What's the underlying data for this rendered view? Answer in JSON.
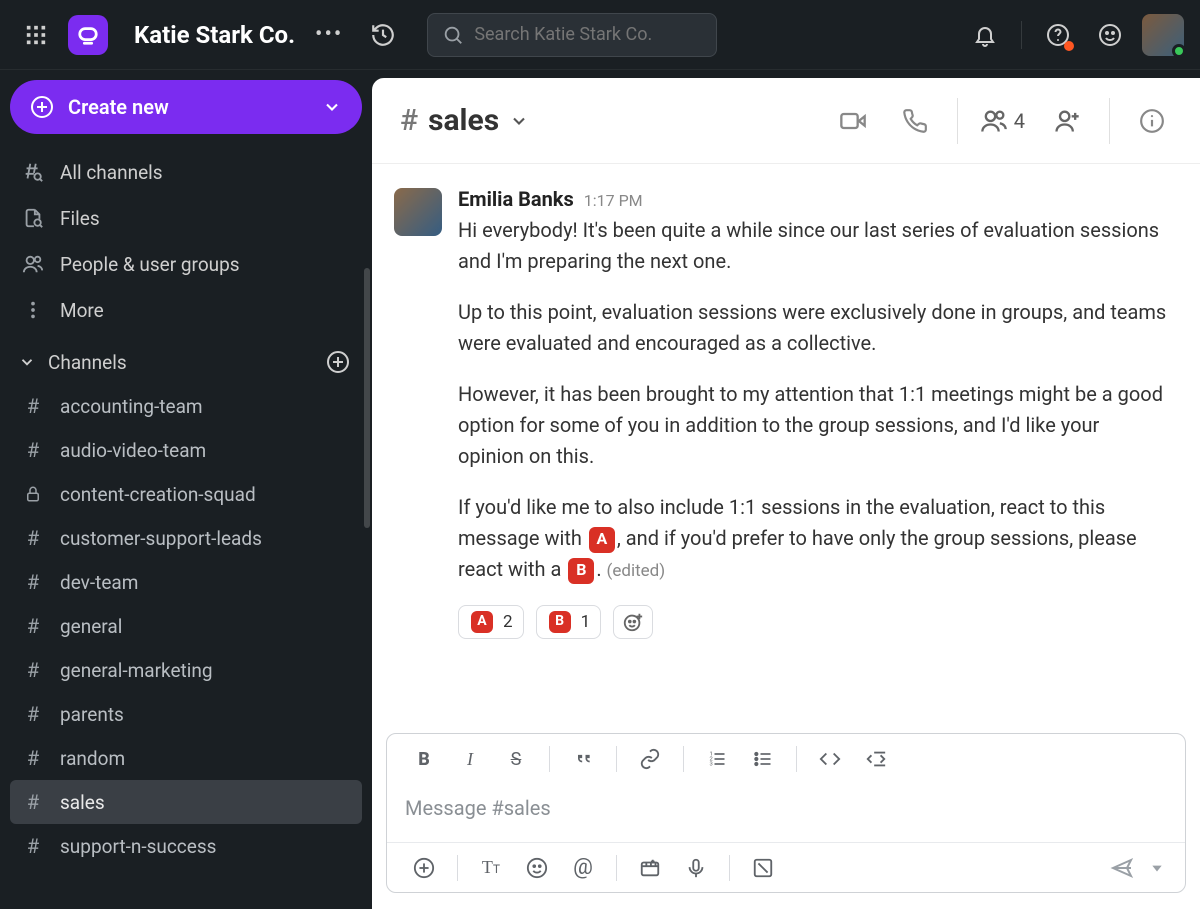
{
  "workspace": {
    "name": "Katie Stark Co."
  },
  "search": {
    "placeholder": "Search Katie Stark Co."
  },
  "sidebar": {
    "create_label": "Create new",
    "nav": [
      {
        "label": "All channels"
      },
      {
        "label": "Files"
      },
      {
        "label": "People & user groups"
      },
      {
        "label": "More"
      }
    ],
    "channels_header": "Channels",
    "channels": [
      {
        "label": "accounting-team",
        "icon": "hash"
      },
      {
        "label": "audio-video-team",
        "icon": "hash"
      },
      {
        "label": "content-creation-squad",
        "icon": "lock"
      },
      {
        "label": "customer-support-leads",
        "icon": "hash"
      },
      {
        "label": "dev-team",
        "icon": "hash"
      },
      {
        "label": "general",
        "icon": "hash"
      },
      {
        "label": "general-marketing",
        "icon": "hash"
      },
      {
        "label": "parents",
        "icon": "hash"
      },
      {
        "label": "random",
        "icon": "hash"
      },
      {
        "label": "sales",
        "icon": "hash",
        "active": true
      },
      {
        "label": "support-n-success",
        "icon": "hash"
      }
    ]
  },
  "channel": {
    "name": "sales",
    "member_count": "4"
  },
  "message": {
    "author": "Emilia Banks",
    "time": "1:17 PM",
    "p1": "Hi everybody! It's been quite a while since our last series of evaluation sessions and I'm preparing the next one.",
    "p2": "Up to this point, evaluation sessions were exclusively done in groups, and teams were evaluated and encouraged as a collective.",
    "p3": "However, it has been brought to my attention that 1:1 meetings might be a good option for some of you in addition to the group sessions, and I'd like your opinion on this.",
    "p4a": "If you'd like me to also include 1:1 sessions in the evaluation, react to this message with ",
    "badge_a": "A",
    "p4b": ", and if you'd prefer to have only the group sessions, please react with a ",
    "badge_b": "B",
    "p4c": ". ",
    "edited": "(edited)",
    "reactions": [
      {
        "letter": "A",
        "count": "2"
      },
      {
        "letter": "B",
        "count": "1"
      }
    ]
  },
  "composer": {
    "placeholder": "Message #sales"
  }
}
